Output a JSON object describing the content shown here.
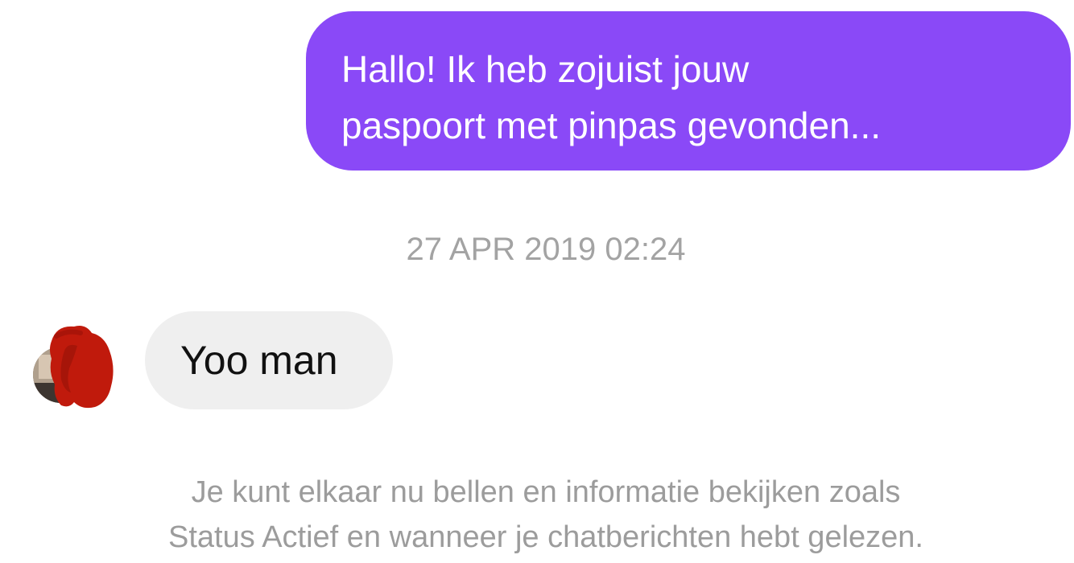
{
  "conversation": {
    "outgoing_message": {
      "lines": [
        "Hallo! Ik heb zojuist jouw",
        "paspoort met pinpas gevonden..."
      ]
    },
    "timestamp": "27 APR 2019 02:24",
    "incoming_message": {
      "text": "Yoo man",
      "avatar_icon": "profile-photo-redacted"
    },
    "info_notice": {
      "lines": [
        "Je kunt elkaar nu bellen en informatie bekijken zoals",
        "Status Actief en wanneer je chatberichten hebt gelezen."
      ]
    }
  },
  "colors": {
    "outgoing_bubble": "#8a49f7",
    "incoming_bubble": "#efefef",
    "timestamp_text": "#a3a3a3",
    "info_text": "#9c9c9c",
    "redaction": "#c01a0c"
  }
}
